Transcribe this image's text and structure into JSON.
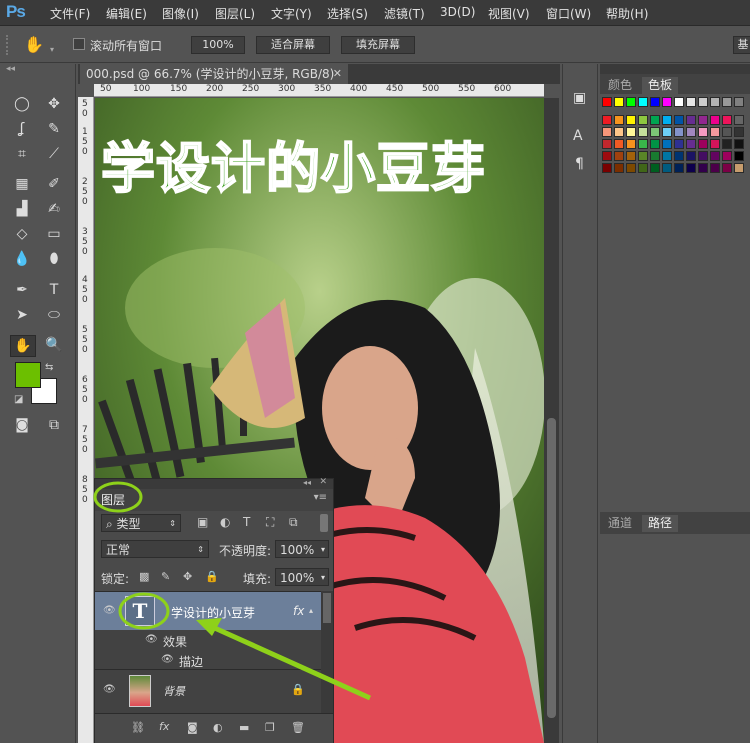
{
  "app": {
    "logo": "Ps"
  },
  "menu": [
    "文件(F)",
    "编辑(E)",
    "图像(I)",
    "图层(L)",
    "文字(Y)",
    "选择(S)",
    "滤镜(T)",
    "3D(D)",
    "视图(V)",
    "窗口(W)",
    "帮助(H)"
  ],
  "options": {
    "scroll_all_label": "滚动所有窗口",
    "zoom_btn": "100%",
    "fit_screen_btn": "适合屏幕",
    "fill_screen_btn": "填充屏幕",
    "right_btn": "基"
  },
  "document": {
    "tab_title": "000.psd @ 66.7% (学设计的小豆芽, RGB/8)",
    "ruler_ticks": [
      "50",
      "100",
      "150",
      "200",
      "250",
      "300",
      "350",
      "400",
      "450",
      "500",
      "550",
      "600"
    ],
    "ruler_left_ticks": [
      "5",
      "0",
      "1",
      "5",
      "0",
      "2",
      "5",
      "0",
      "3",
      "5",
      "0",
      "4",
      "5",
      "0",
      "5",
      "5",
      "0",
      "6",
      "5",
      "0",
      "7",
      "5",
      "0",
      "8",
      "5",
      "0"
    ],
    "canvas_text": "学设计的小豆芽"
  },
  "swatches_panel": {
    "tabs": [
      "颜色",
      "色板"
    ],
    "active": "色板"
  },
  "paths_panel": {
    "tabs": [
      "通道",
      "路径"
    ],
    "active": "路径"
  },
  "layers_panel": {
    "title": "图层",
    "filter_kind": "类型",
    "blend_mode": "正常",
    "opacity_label": "不透明度:",
    "opacity": "100%",
    "lock_label": "锁定:",
    "fill_label": "填充:",
    "fill": "100%",
    "layers": [
      {
        "name": "学设计的小豆芽",
        "fx": "fx",
        "effects_label": "效果",
        "effect": "描边"
      },
      {
        "name": "背景"
      }
    ]
  },
  "colors": {
    "foreground": "#6cbf00",
    "background": "#ffffff",
    "highlight": "#8ed11a"
  }
}
